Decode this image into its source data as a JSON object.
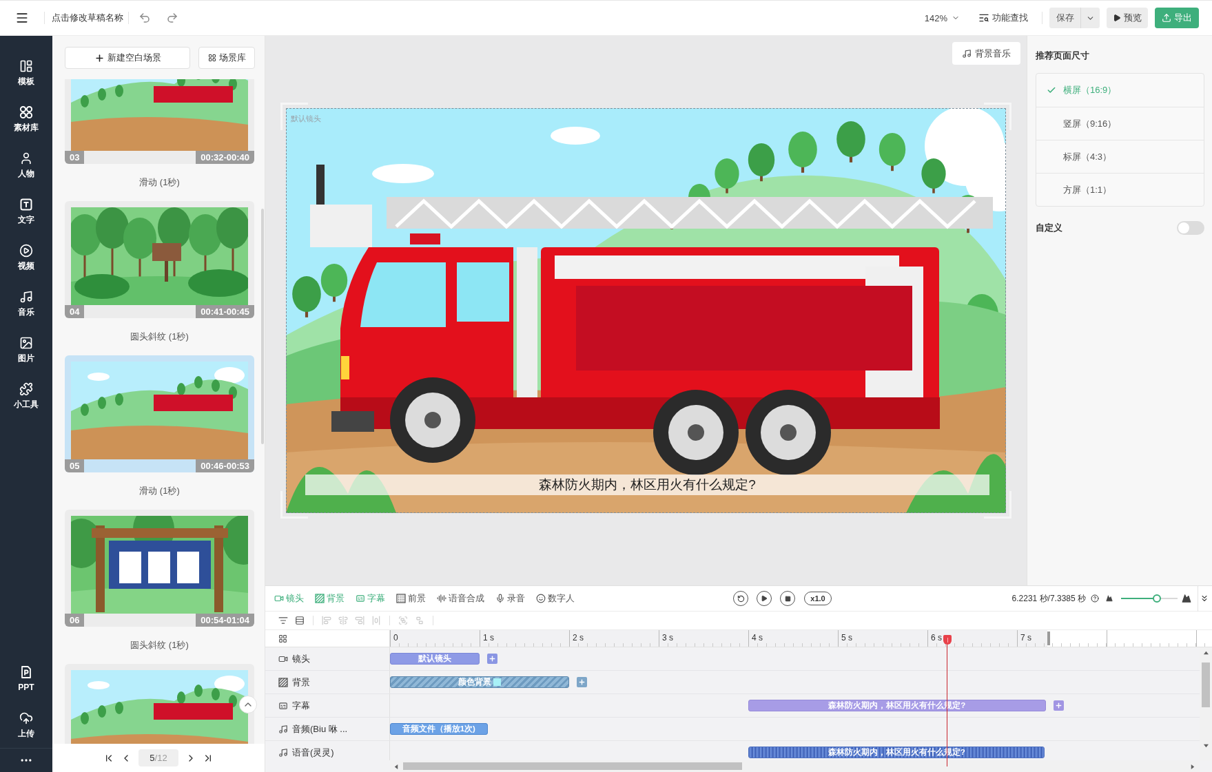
{
  "top_bar": {
    "draft_name": "点击修改草稿名称",
    "zoom": "142%",
    "search": "功能查找",
    "save": "保存",
    "preview": "预览",
    "export": "导出"
  },
  "sidebar": {
    "items": [
      {
        "label": "模板"
      },
      {
        "label": "素材库"
      },
      {
        "label": "人物"
      },
      {
        "label": "文字"
      },
      {
        "label": "视频"
      },
      {
        "label": "音乐"
      },
      {
        "label": "图片"
      },
      {
        "label": "小工具"
      }
    ],
    "bottom_items": [
      {
        "label": "PPT"
      },
      {
        "label": "上传"
      }
    ]
  },
  "scene_panel": {
    "new_scene": "新建空白场景",
    "library": "场景库",
    "scenes": [
      {
        "kind": "hillside",
        "number": "03",
        "time": "00:32-00:40",
        "transition": "滑动 (1秒)",
        "selected": false
      },
      {
        "kind": "forest",
        "number": "04",
        "time": "00:41-00:45",
        "transition": "圆头斜纹 (1秒)",
        "selected": false
      },
      {
        "kind": "hillside",
        "number": "05",
        "time": "00:46-00:53",
        "transition": "滑动 (1秒)",
        "selected": true
      },
      {
        "kind": "notice_board",
        "number": "06",
        "time": "00:54-01:04",
        "transition": "圆头斜纹 (1秒)",
        "selected": false
      },
      {
        "kind": "hillside",
        "selected": false
      }
    ],
    "pagination": {
      "current": "5",
      "total": "/12"
    }
  },
  "canvas": {
    "music_button": "背景音乐",
    "camera_label": "默认镜头",
    "subtitle": "森林防火期内，林区用火有什么规定?"
  },
  "size_panel": {
    "title": "推荐页面尺寸",
    "options": [
      {
        "label": "横屏（16:9）",
        "selected": true
      },
      {
        "label": "竖屏（9:16）",
        "selected": false
      },
      {
        "label": "标屏（4:3）",
        "selected": false
      },
      {
        "label": "方屏（1:1）",
        "selected": false
      }
    ],
    "custom": {
      "label": "自定义",
      "on": false
    }
  },
  "timeline": {
    "tools": [
      {
        "label": "镜头",
        "active": true
      },
      {
        "label": "背景",
        "active": true
      },
      {
        "label": "字幕",
        "active": true
      },
      {
        "label": "前景",
        "active": false
      },
      {
        "label": "语音合成",
        "active": false
      },
      {
        "label": "录音",
        "active": false
      },
      {
        "label": "数字人",
        "active": false
      }
    ],
    "speed": "x1.0",
    "time": "6.2231 秒/7.3385 秒",
    "zoom": {
      "level": 0.63
    },
    "edit_tools": [
      {
        "disabled": false
      },
      {
        "disabled": false
      },
      {
        "disabled": true
      },
      {
        "disabled": true
      },
      {
        "disabled": true
      },
      {
        "disabled": true
      },
      {
        "disabled": true
      },
      {
        "disabled": true
      }
    ],
    "ruler": [
      "0",
      "1 s",
      "2 s",
      "3 s",
      "4 s",
      "5 s",
      "6 s",
      "7 s"
    ],
    "playhead": {
      "level": 0.848
    },
    "tracks": [
      {
        "kind": "camera",
        "label": "镜头",
        "clips": [
          {
            "text": "默认镜头"
          }
        ],
        "can_add": true
      },
      {
        "kind": "background",
        "label": "背景",
        "clips": [
          {
            "text": "颜色背景"
          }
        ],
        "can_add": true
      },
      {
        "kind": "subtitle",
        "label": "字幕",
        "clips": [
          {
            "text": "森林防火期内，林区用火有什么规定?"
          }
        ],
        "can_add": true
      },
      {
        "kind": "audio",
        "label": "音频(Biu 咻 ...",
        "clips": [
          {
            "text": "音频文件（播放1次)"
          }
        ],
        "can_add": false
      },
      {
        "kind": "voice",
        "label": "语音(灵灵)",
        "clips": [
          {
            "text": "森林防火期内，林区用火有什么规定?"
          }
        ],
        "can_add": false
      }
    ]
  }
}
